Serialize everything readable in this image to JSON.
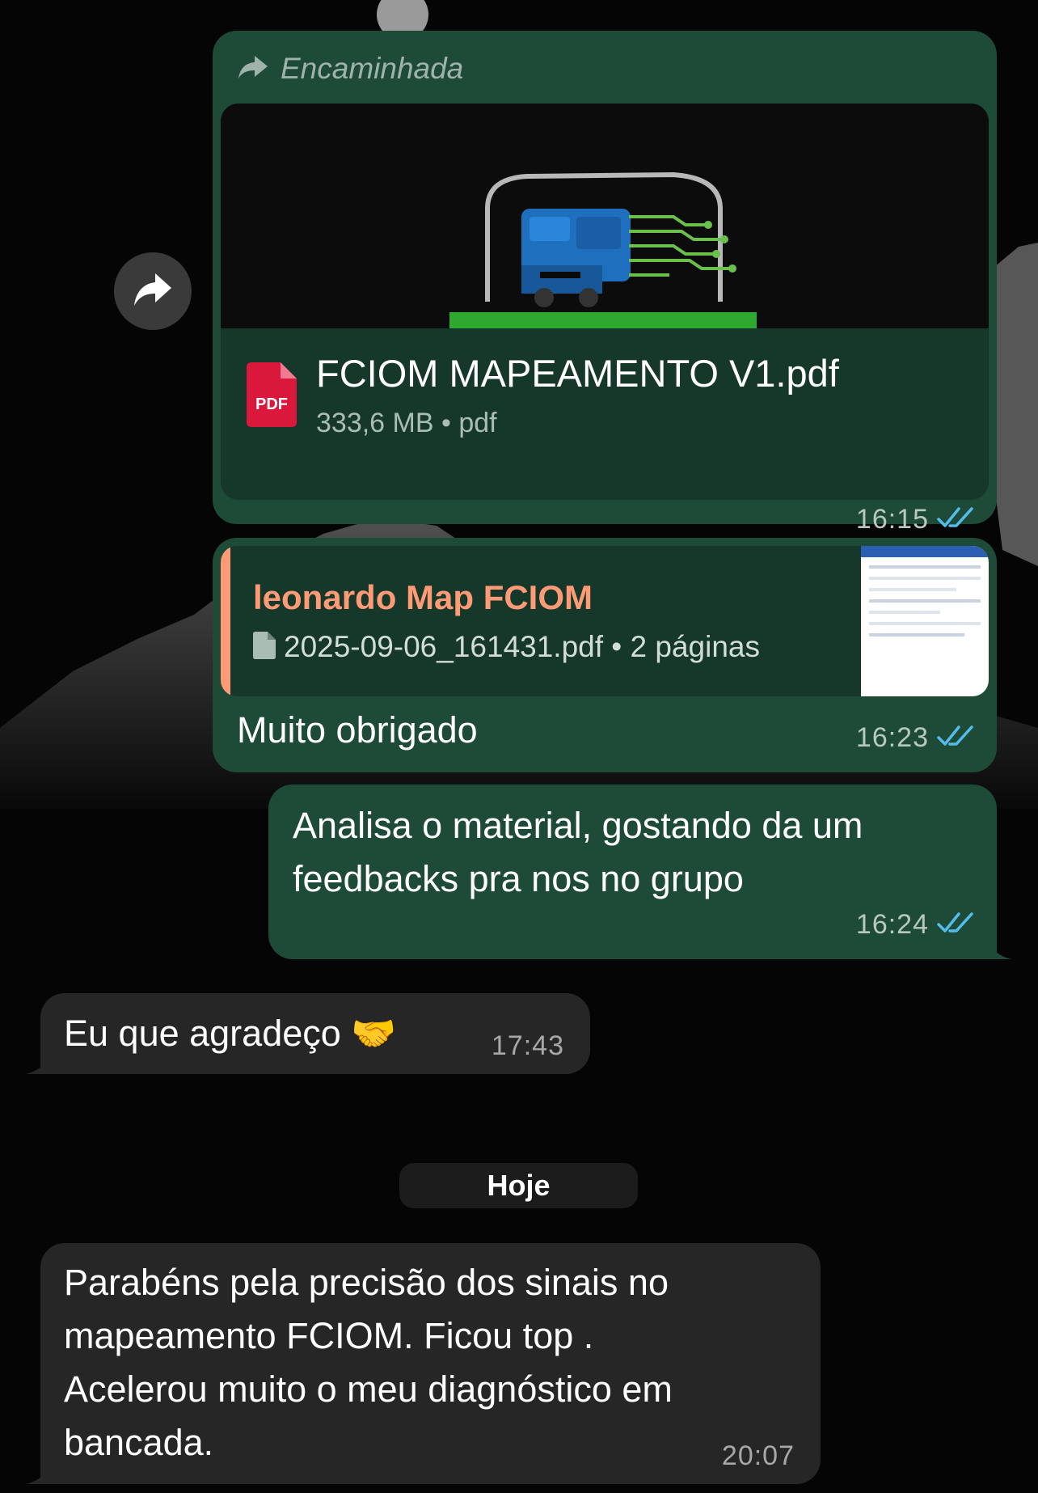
{
  "colors": {
    "outgoing_bubble": "#1d4b38",
    "incoming_bubble": "#262626",
    "read_ticks": "#53bdeb",
    "quote_name": "#ff9a76",
    "pdf_icon": "#d9183b"
  },
  "messages": [
    {
      "forward_label": "Encaminhada",
      "document": {
        "filename": "FCIOM MAPEAMENTO V1.pdf",
        "meta": "333,6 MB • pdf",
        "icon_label": "PDF"
      },
      "time": "16:15"
    },
    {
      "quote": {
        "author": "leonardo Map FCIOM",
        "file": "2025-09-06_161431.pdf • 2 páginas"
      },
      "text": "Muito obrigado",
      "time": "16:23"
    },
    {
      "text_lines": [
        "Analisa o material, gostando da um",
        "feedbacks pra nos no grupo"
      ],
      "time": "16:24"
    },
    {
      "text": "Eu que agradeço 🤝",
      "time": "17:43"
    },
    {
      "text_lines": [
        "Parabéns pela precisão dos  sinais no",
        "mapeamento FCIOM. Ficou top .",
        "Acelerou muito o meu diagnóstico em",
        "bancada."
      ],
      "time": "20:07"
    }
  ],
  "date_separator": "Hoje",
  "icons": [
    "forward-icon",
    "pdf-icon",
    "file-icon",
    "double-check-icon"
  ]
}
